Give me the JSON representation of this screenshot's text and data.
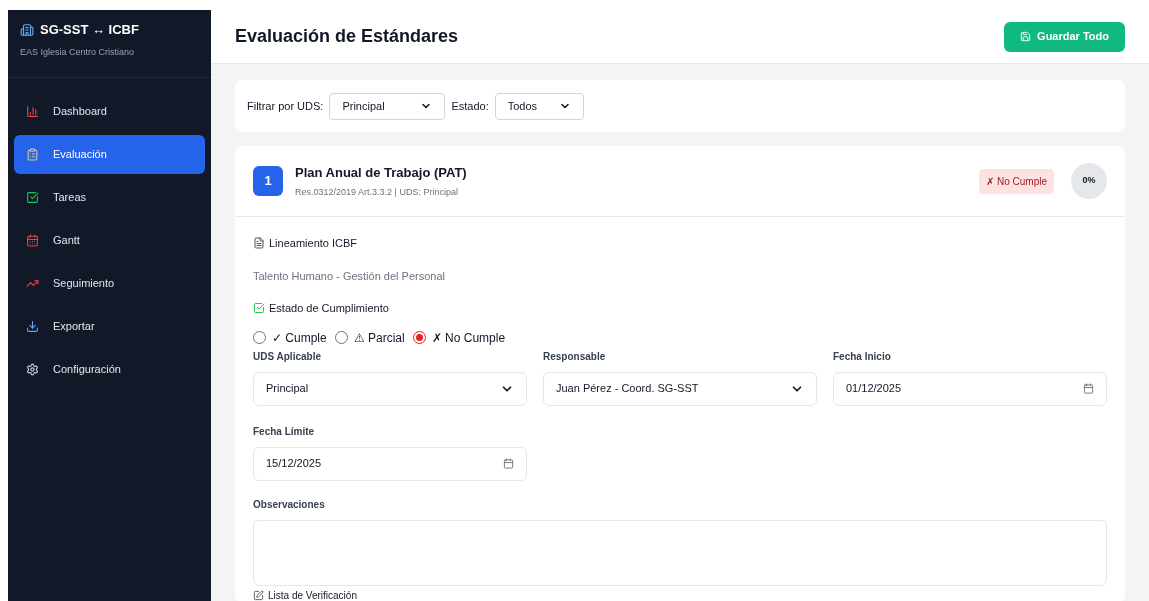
{
  "sidebar": {
    "title": "SG-SST ↔ ICBF",
    "subtitle": "EAS Iglesia Centro Cristiano",
    "items": [
      {
        "label": "Dashboard",
        "kind": "chart",
        "selected": false
      },
      {
        "label": "Evaluación",
        "kind": "clipboard",
        "selected": true
      },
      {
        "label": "Tareas",
        "kind": "check",
        "selected": false
      },
      {
        "label": "Gantt",
        "kind": "calendar",
        "selected": false
      },
      {
        "label": "Seguimiento",
        "kind": "trend",
        "selected": false
      },
      {
        "label": "Exportar",
        "kind": "export",
        "selected": false
      },
      {
        "label": "Configuración",
        "kind": "gear",
        "selected": false
      }
    ]
  },
  "header": {
    "title": "Evaluación de Estándares",
    "save_button": "Guardar Todo"
  },
  "filters": [
    {
      "label": "Filtrar por UDS:",
      "value": "Principal"
    },
    {
      "label": "Estado:",
      "value": "Todos"
    }
  ],
  "standard": {
    "number": "1",
    "title": "Plan Anual de Trabajo (PAT)",
    "meta": "Res.0312/2019 Art.3.3.2 | UDS: Principal",
    "status_badge": "✗ No Cumple",
    "percent": "0%",
    "guideline_heading": "Lineamiento ICBF",
    "guideline_text": "Talento Humano - Gestión del Personal",
    "compliance_heading": "Estado de Cumplimiento",
    "options": [
      {
        "label": "✓ Cumple",
        "selected": false
      },
      {
        "label": "⚠ Parcial",
        "selected": false
      },
      {
        "label": "✗ No Cumple",
        "selected": true
      }
    ],
    "fields": [
      {
        "label": "UDS Aplicable",
        "kind": "select",
        "value": "Principal"
      },
      {
        "label": "Responsable",
        "kind": "select",
        "value": "Juan Pérez - Coord. SG-SST"
      },
      {
        "label": "Fecha Inicio",
        "kind": "date",
        "value": "01/12/2025"
      },
      {
        "label": "Fecha Límite",
        "kind": "date",
        "value": "15/12/2025"
      }
    ],
    "observations_label": "Observaciones",
    "checklist_heading": "Lista de Verificación"
  }
}
